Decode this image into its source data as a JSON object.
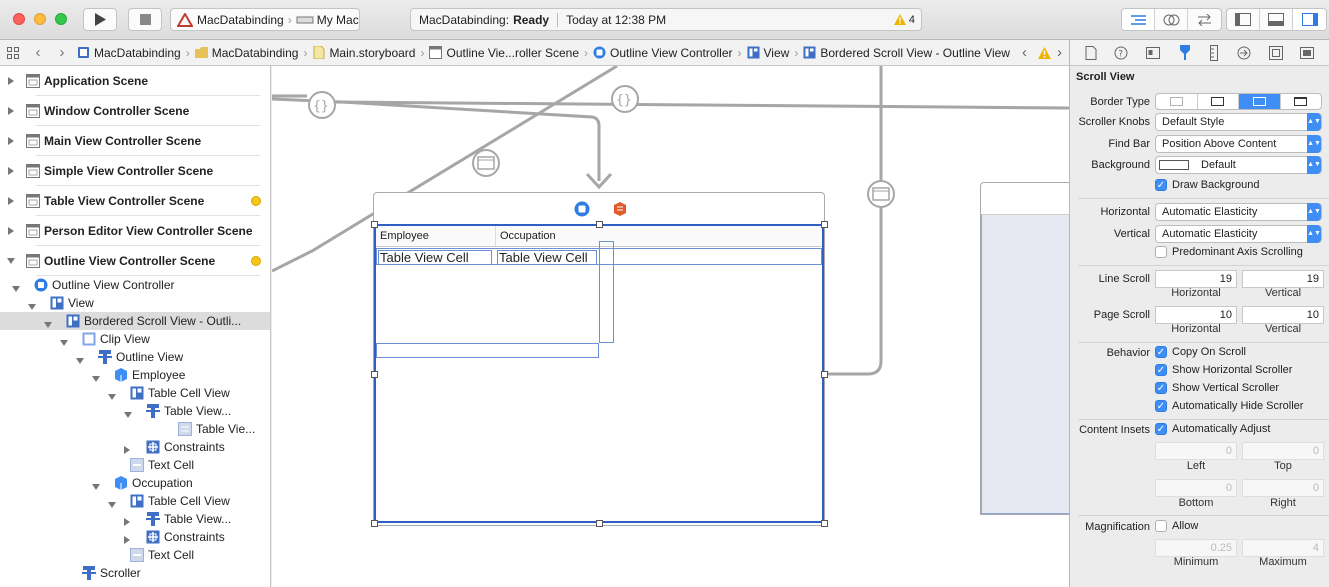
{
  "toolbar": {
    "scheme_target": "MacDatabinding",
    "scheme_device": "My Mac",
    "status_project": "MacDatabinding:",
    "status_state": "Ready",
    "status_time": "Today at 12:38 PM",
    "warning_count": "4"
  },
  "jumpbar": {
    "items": [
      "MacDatabinding",
      "MacDatabinding",
      "Main.storyboard",
      "Outline Vie...roller Scene",
      "Outline View Controller",
      "View",
      "Bordered Scroll View - Outline View"
    ]
  },
  "outline": {
    "scenes": [
      "Application Scene",
      "Window Controller Scene",
      "Main View Controller Scene",
      "Simple View Controller Scene",
      "Table View Controller Scene",
      "Person Editor View Controller Scene",
      "Outline View Controller Scene"
    ],
    "tree": [
      "Outline View Controller",
      "View",
      "Bordered Scroll View - Outli...",
      "Clip View",
      "Outline View",
      "Employee",
      "Table Cell View",
      "Table View...",
      "Table Vie...",
      "Constraints",
      "Text Cell",
      "Occupation",
      "Table Cell View",
      "Table View...",
      "Constraints",
      "Text Cell",
      "Scroller"
    ]
  },
  "canvas": {
    "columns": [
      "Employee",
      "Occupation"
    ],
    "cells": [
      "Table View Cell",
      "Table View Cell"
    ]
  },
  "inspector": {
    "section_title": "Scroll View",
    "border_type_label": "Border Type",
    "scroller_knobs_label": "Scroller Knobs",
    "scroller_knobs_value": "Default Style",
    "find_bar_label": "Find Bar",
    "find_bar_value": "Position Above Content",
    "background_label": "Background",
    "background_value": "Default",
    "draw_background": "Draw Background",
    "horizontal_label": "Horizontal",
    "horizontal_value": "Automatic Elasticity",
    "vertical_label": "Vertical",
    "vertical_value": "Automatic Elasticity",
    "predominant": "Predominant Axis Scrolling",
    "line_scroll_label": "Line Scroll",
    "line_scroll_h": "19",
    "line_scroll_v": "19",
    "page_scroll_label": "Page Scroll",
    "page_scroll_h": "10",
    "page_scroll_v": "10",
    "sub_horizontal": "Horizontal",
    "sub_vertical": "Vertical",
    "behavior_label": "Behavior",
    "copy_on_scroll": "Copy On Scroll",
    "show_h_scroller": "Show Horizontal Scroller",
    "show_v_scroller": "Show Vertical Scroller",
    "auto_hide": "Automatically Hide Scroller",
    "content_insets_label": "Content Insets",
    "auto_adjust": "Automatically Adjust",
    "inset_left": "0",
    "inset_top": "0",
    "inset_bottom": "0",
    "inset_right": "0",
    "sub_left": "Left",
    "sub_top": "Top",
    "sub_bottom": "Bottom",
    "sub_right": "Right",
    "magnification_label": "Magnification",
    "allow": "Allow",
    "mag_min": "0.25",
    "mag_max": "4",
    "sub_minimum": "Minimum",
    "sub_maximum": "Maximum"
  },
  "colors": {
    "accent": "#3f8ef5",
    "selection": "#2f5fc4",
    "connection": "#a6a6a6"
  }
}
